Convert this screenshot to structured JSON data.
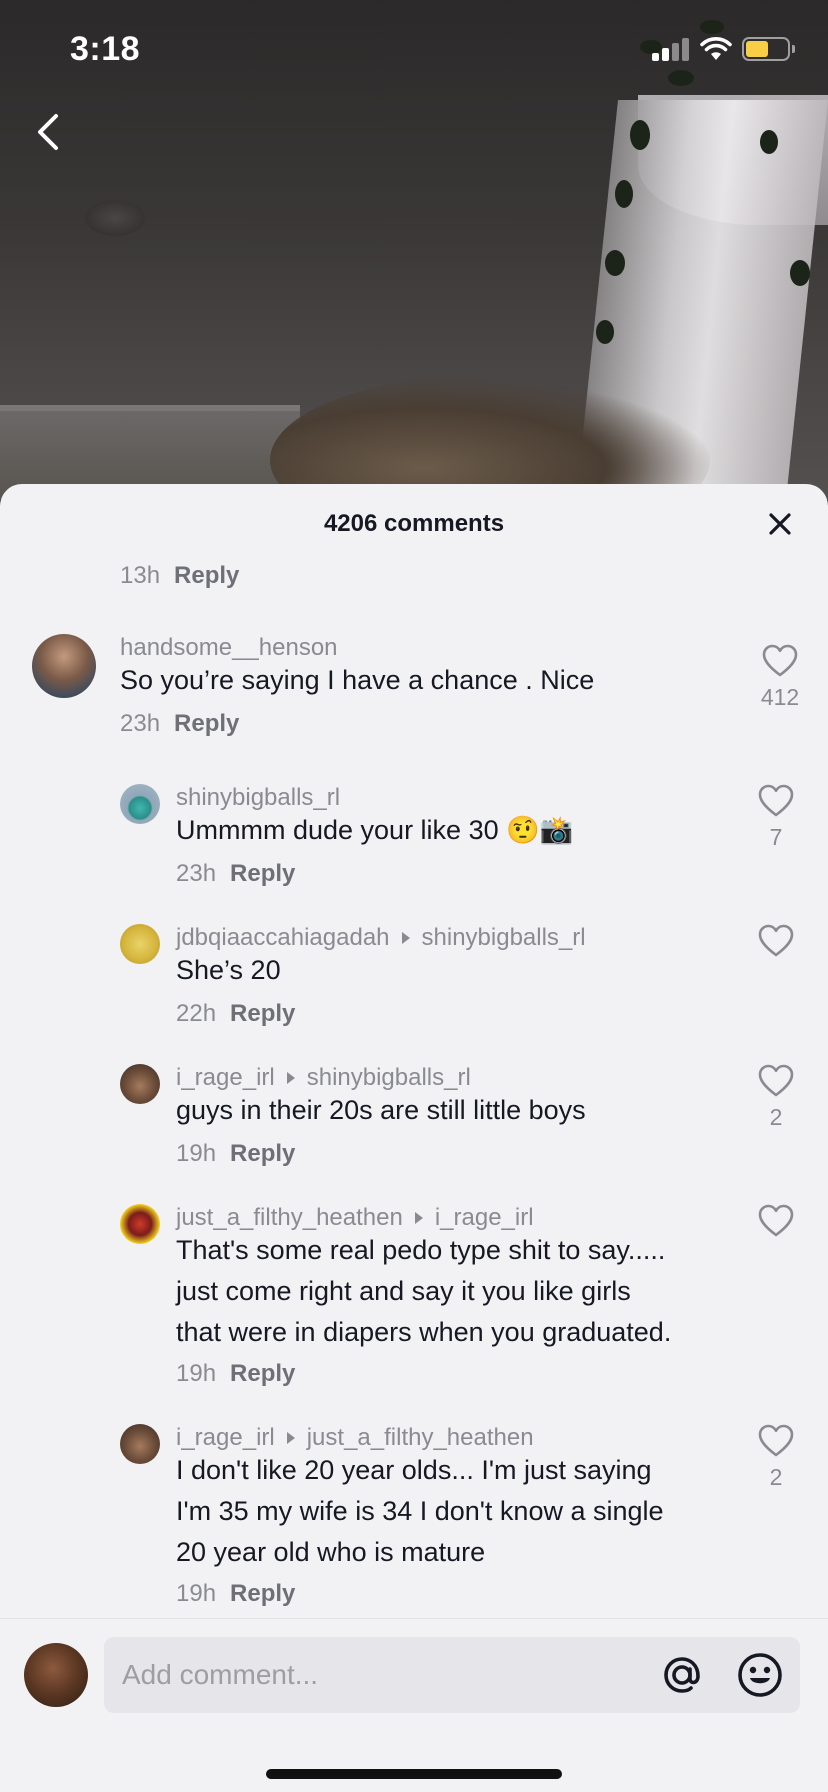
{
  "status_bar": {
    "time": "3:18"
  },
  "sheet": {
    "title": "4206 comments"
  },
  "top_partial": {
    "time": "13h",
    "reply": "Reply"
  },
  "comments": [
    {
      "user": "handsome__henson",
      "reply_to": "",
      "text": "So you’re saying I have a chance . Nice",
      "time": "23h",
      "reply": "Reply",
      "likes": "412"
    },
    {
      "user": "shinybigballs_rl",
      "reply_to": "",
      "text": "Ummmm dude your like 30 🤨📸",
      "time": "23h",
      "reply": "Reply",
      "likes": "7"
    },
    {
      "user": "jdbqiaaccahiagadah",
      "reply_to": "shinybigballs_rl",
      "text": "She’s 20",
      "time": "22h",
      "reply": "Reply",
      "likes": ""
    },
    {
      "user": "i_rage_irl",
      "reply_to": "shinybigballs_rl",
      "text": "guys in their 20s are still little boys",
      "time": "19h",
      "reply": "Reply",
      "likes": "2"
    },
    {
      "user": "just_a_filthy_heathen",
      "reply_to": "i_rage_irl",
      "text_lines": [
        "That's some real pedo type shit to say.....",
        "just come right and say it you like girls",
        "that were in diapers when you graduated."
      ],
      "time": "19h",
      "reply": "Reply",
      "likes": ""
    },
    {
      "user": "i_rage_irl",
      "reply_to": "just_a_filthy_heathen",
      "text_lines": [
        "I don't like 20 year olds... I'm just saying",
        "I'm 35 my wife is 34 I don't know a single",
        "20 year old who is mature"
      ],
      "time": "19h",
      "reply": "Reply",
      "likes": "2"
    }
  ],
  "input": {
    "placeholder": "Add comment..."
  },
  "icons": {
    "back": "chevron-left-icon",
    "close": "close-icon",
    "like": "heart-outline-icon",
    "mention": "at-sign-icon",
    "emoji": "smiley-icon"
  }
}
